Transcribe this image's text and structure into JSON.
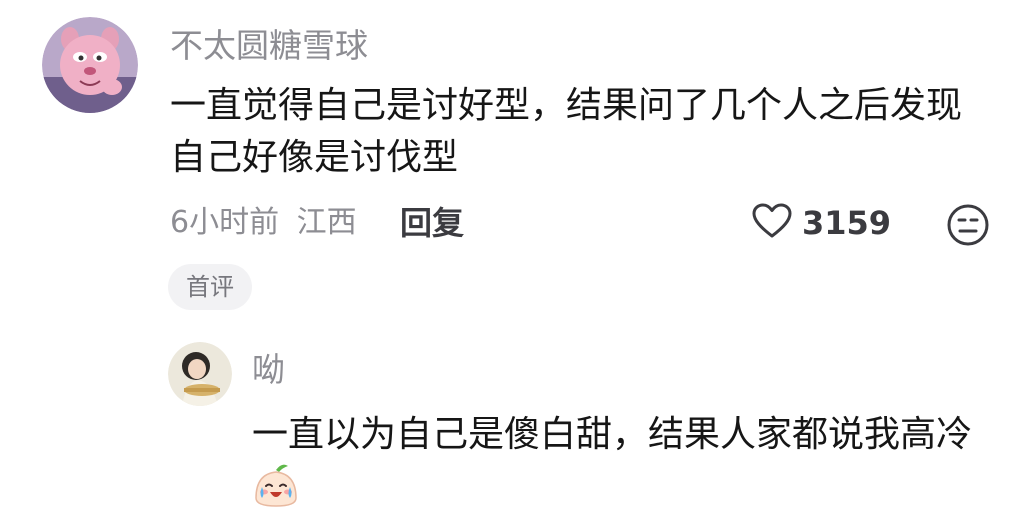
{
  "main_comment": {
    "username": "不太圆糖雪球",
    "avatar_icon": "pink-panther-avatar-icon",
    "text": "一直觉得自己是讨好型，结果问了几个人之后发现自己好像是讨伐型",
    "time": "6小时前",
    "location": "江西",
    "reply_label": "回复",
    "like_icon": "heart-outline-icon",
    "likes": "3159",
    "reaction_icon": "neutral-face-icon",
    "badge": "首评"
  },
  "reply": {
    "username": "呦",
    "avatar_icon": "woman-photo-avatar-icon",
    "text": "一直以为自己是傻白甜，结果人家都说我高冷",
    "emoji_icon": "crying-laughing-bun-emoji-icon"
  },
  "colors": {
    "secondary_text": "#8d8d93",
    "primary_text": "#161616",
    "badge_bg": "#f2f2f4"
  }
}
